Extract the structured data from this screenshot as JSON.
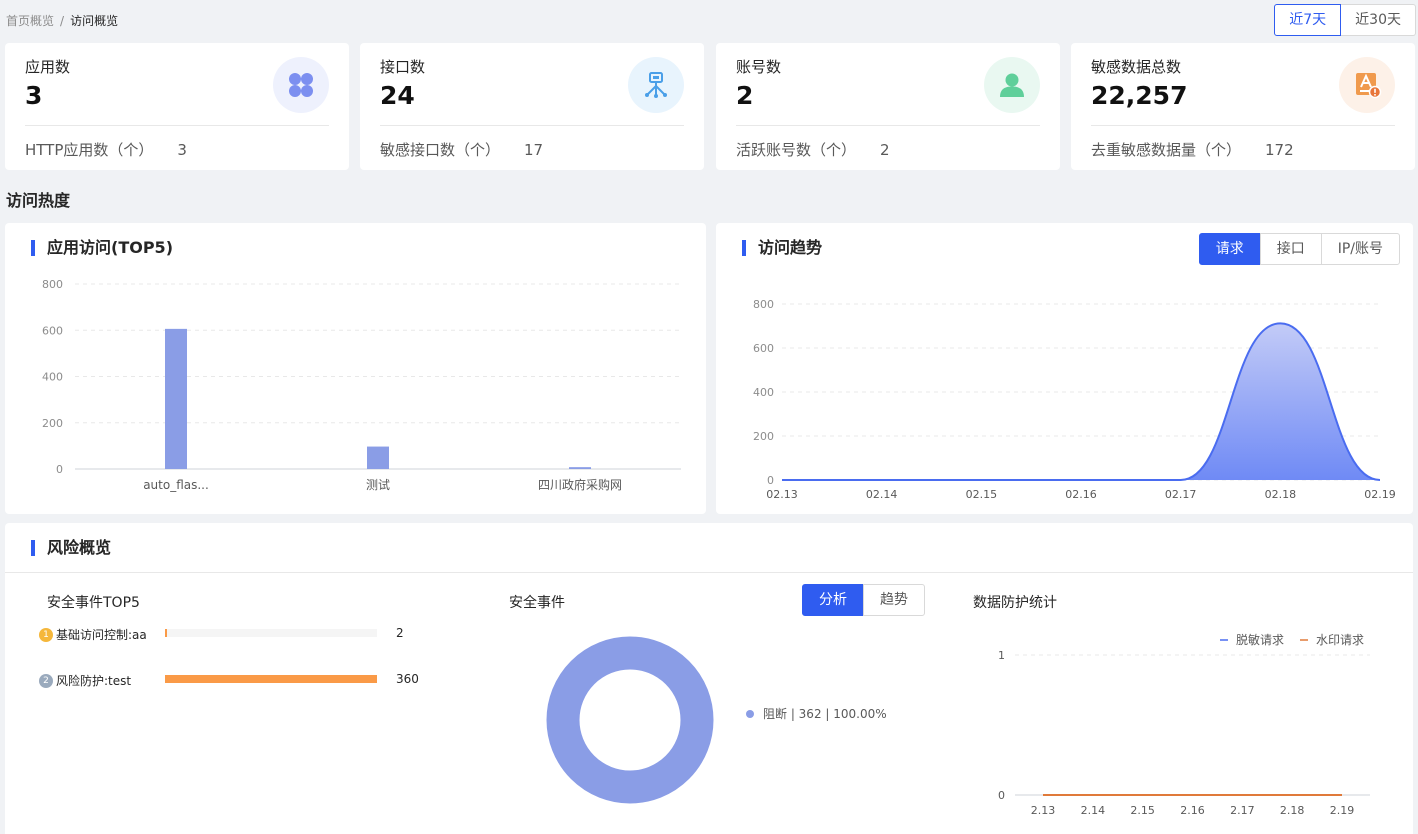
{
  "breadcrumb": {
    "home": "首页概览",
    "separator": "/",
    "current": "访问概览"
  },
  "range": {
    "options": [
      "近7天",
      "近30天"
    ],
    "active": 0
  },
  "stats": [
    {
      "label": "应用数",
      "value": "3",
      "sub_label": "HTTP应用数（个）",
      "sub_value": "3",
      "icon": "apps-grid-icon",
      "icon_bg": "#eef1fd",
      "icon_color": "#7c8ff0"
    },
    {
      "label": "接口数",
      "value": "24",
      "sub_label": "敏感接口数（个）",
      "sub_value": "17",
      "icon": "api-branch-icon",
      "icon_bg": "#e8f4fd",
      "icon_color": "#4a9fe8"
    },
    {
      "label": "账号数",
      "value": "2",
      "sub_label": "活跃账号数（个）",
      "sub_value": "2",
      "icon": "user-icon",
      "icon_bg": "#e9f8f1",
      "icon_color": "#5fcf9a"
    },
    {
      "label": "敏感数据总数",
      "value": "22,257",
      "sub_label": "去重敏感数据量（个）",
      "sub_value": "172",
      "icon": "sensitive-data-icon",
      "icon_bg": "#fdf1e8",
      "icon_color": "#f09a4d"
    }
  ],
  "heat_section_title": "访问热度",
  "app_access": {
    "title": "应用访问(TOP5)",
    "chart_data": {
      "type": "bar",
      "categories": [
        "auto_flas...",
        "测试",
        "四川政府采购网"
      ],
      "values": [
        606,
        97,
        8
      ],
      "ylim": [
        0,
        800
      ],
      "yticks": [
        0,
        200,
        400,
        600,
        800
      ],
      "color": "#8a9de6"
    }
  },
  "access_trend": {
    "title": "访问趋势",
    "tabs": [
      "请求",
      "接口",
      "IP/账号"
    ],
    "active_tab": 0,
    "chart_data": {
      "type": "area",
      "x": [
        "02.13",
        "02.14",
        "02.15",
        "02.16",
        "02.17",
        "02.18",
        "02.19"
      ],
      "values": [
        0,
        0,
        0,
        0,
        0,
        712,
        0
      ],
      "ylim": [
        0,
        800
      ],
      "yticks": [
        0,
        200,
        400,
        600,
        800
      ],
      "line_color": "#4a6cf0"
    }
  },
  "risk": {
    "title": "风险概览",
    "top5": {
      "title": "安全事件TOP5",
      "items": [
        {
          "rank": "1",
          "name": "基础访问控制:aa",
          "value": 2,
          "medal_color": "#f5b73b"
        },
        {
          "rank": "2",
          "name": "风险防护:test",
          "value": 360,
          "medal_color": "#9aaabd"
        }
      ],
      "max": 360
    },
    "events": {
      "title": "安全事件",
      "tabs": [
        "分析",
        "趋势"
      ],
      "active_tab": 0,
      "chart_data": {
        "type": "pie",
        "labels": [
          "阻断"
        ],
        "values": [
          362
        ],
        "legend": [
          "阻断 | 362 | 100.00%"
        ],
        "colors": [
          "#8a9de6"
        ]
      }
    },
    "protection": {
      "title": "数据防护统计",
      "chart_data": {
        "type": "line",
        "x": [
          "2.13",
          "2.14",
          "2.15",
          "2.16",
          "2.17",
          "2.18",
          "2.19"
        ],
        "series": [
          {
            "name": "脱敏请求",
            "values": [
              0,
              0,
              0,
              0,
              0,
              0,
              0
            ],
            "color": "#4a6cf0"
          },
          {
            "name": "水印请求",
            "values": [
              0,
              0,
              0,
              0,
              0,
              0,
              0
            ],
            "color": "#e07a3a"
          }
        ],
        "ylim": [
          0,
          1
        ],
        "yticks": [
          0,
          1
        ],
        "legend_position": "top-right"
      }
    }
  }
}
